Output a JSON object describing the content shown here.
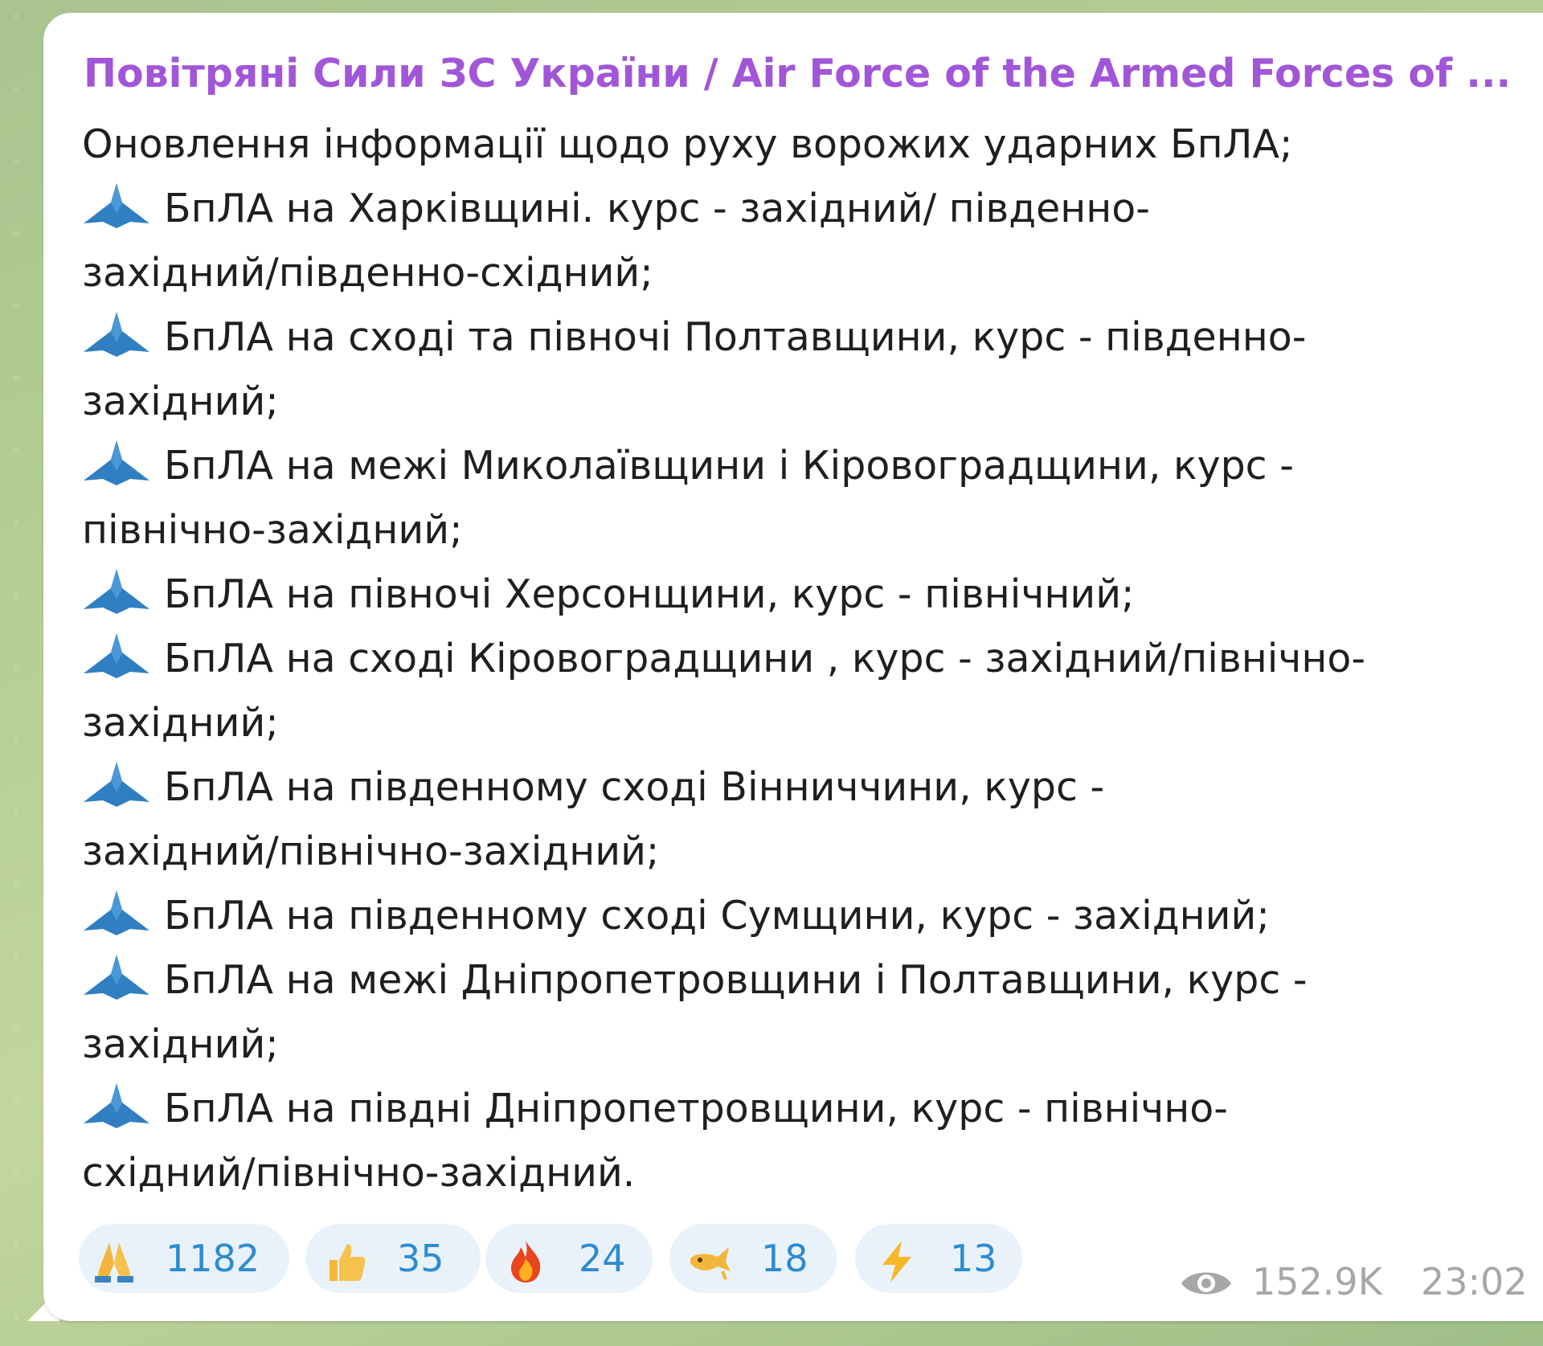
{
  "message": {
    "channel_name": "Повітряні Сили ЗС України / Air Force of the Armed Forces of ...",
    "lines": [
      {
        "icon": "",
        "text": "Оновлення інформації щодо руху ворожих ударних БпЛА;"
      },
      {
        "icon": "drone-icon",
        "text": "БпЛА на Харківщині. курс - західний/ південно-"
      },
      {
        "icon": "",
        "text": "західний/південно-східний;"
      },
      {
        "icon": "drone-icon",
        "text": "БпЛА на сході та півночі Полтавщини, курс - південно-"
      },
      {
        "icon": "",
        "text": "західний;"
      },
      {
        "icon": "drone-icon",
        "text": "БпЛА на межі Миколаївщини і Кіровоградщини, курс -"
      },
      {
        "icon": "",
        "text": "північно-західний;"
      },
      {
        "icon": "drone-icon",
        "text": "БпЛА на півночі Херсонщини, курс - північний;"
      },
      {
        "icon": "drone-icon",
        "text": "БпЛА на сході Кіровоградщини , курс - західний/північно-"
      },
      {
        "icon": "",
        "text": "західний;"
      },
      {
        "icon": "drone-icon",
        "text": "БпЛА на південному сході Вінниччини, курс -"
      },
      {
        "icon": "",
        "text": "західний/північно-західний;"
      },
      {
        "icon": "drone-icon",
        "text": "БпЛА на південному сході Сумщини, курс - західний;"
      },
      {
        "icon": "drone-icon",
        "text": "БпЛА на межі Дніпропетровщини і Полтавщини, курс -"
      },
      {
        "icon": "",
        "text": "західний;"
      },
      {
        "icon": "drone-icon",
        "text": "БпЛА на півдні Дніпропетровщини, курс - північно-"
      },
      {
        "icon": "",
        "text": "східний/північно-західний."
      }
    ]
  },
  "reactions": [
    {
      "icon": "praying-hands-icon",
      "count": "1182"
    },
    {
      "icon": "thumbs-up-icon",
      "count": "35"
    },
    {
      "icon": "fire-icon",
      "count": "24"
    },
    {
      "icon": "whale-icon",
      "count": "18"
    },
    {
      "icon": "lightning-icon",
      "count": "13"
    }
  ],
  "meta": {
    "views": "152.9K",
    "time": "23:02",
    "eye_icon": "eye-icon"
  },
  "colors": {
    "channel_name": "#a156d8",
    "text": "#1f1f1f",
    "reaction_bg": "#e9f2fb",
    "reaction_text": "#2d8bd0",
    "meta_text": "#a7a7a7",
    "drone_icon": "#2f7fc2"
  }
}
